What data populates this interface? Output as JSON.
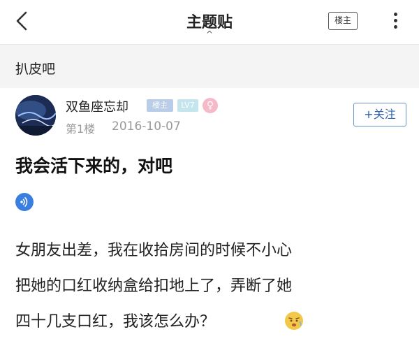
{
  "header": {
    "title": "主题贴",
    "title_caret": "^",
    "op_button_label": "楼主"
  },
  "forum": {
    "name": "扒皮吧"
  },
  "post": {
    "author": "双鱼座忘却",
    "badge_lz": "楼主",
    "badge_level": "LV7",
    "gender_symbol": "♀",
    "floor": "第1楼",
    "date": "2016-10-07",
    "follow_label": "+关注",
    "title": "我会活下来的，对吧",
    "lines": [
      "女朋友出差，我在收拾房间的时候不小心",
      "把她的口红收纳盒给扣地上了，弄断了她",
      "四十几支口红，我该怎么办？"
    ]
  },
  "colors": {
    "link_blue": "#2f63b0",
    "forum_bar_bg": "#f4f4f4",
    "meta_gray": "#999999"
  }
}
